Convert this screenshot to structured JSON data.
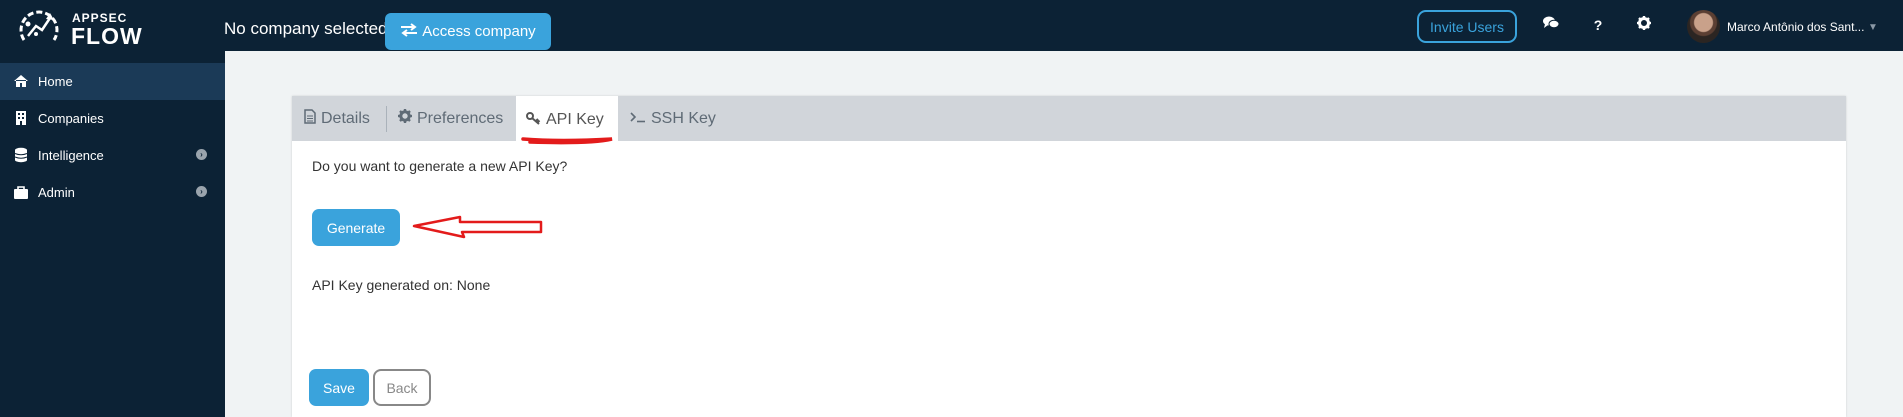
{
  "brand": {
    "line1": "APPSEC",
    "line2": "FLOW"
  },
  "header": {
    "company_status": "No company selected",
    "access_company_label": "Access company",
    "invite_users_label": "Invite Users",
    "help_label": "?",
    "user_name": "Marco Antônio dos Sant...",
    "icons": [
      "chat-icon",
      "help-icon",
      "gear-icon",
      "caret-down-icon"
    ]
  },
  "sidebar": {
    "items": [
      {
        "label": "Home",
        "icon": "home-icon",
        "active": true
      },
      {
        "label": "Companies",
        "icon": "building-icon",
        "active": false
      },
      {
        "label": "Intelligence",
        "icon": "database-icon",
        "active": false,
        "expandable": true
      },
      {
        "label": "Admin",
        "icon": "briefcase-icon",
        "active": false,
        "expandable": true
      }
    ]
  },
  "tabs": [
    {
      "label": "Details",
      "icon": "document-icon",
      "active": false
    },
    {
      "label": "Preferences",
      "icon": "gear-icon",
      "active": false
    },
    {
      "label": "API Key",
      "icon": "key-icon",
      "active": true
    },
    {
      "label": "SSH Key",
      "icon": "terminal-icon",
      "active": false
    }
  ],
  "api_key": {
    "question": "Do you want to generate a new API Key?",
    "generate_label": "Generate",
    "generated_on_label": "API Key generated on: None"
  },
  "form": {
    "save_label": "Save",
    "back_label": "Back"
  },
  "colors": {
    "navy": "#0c2235",
    "accent": "#3aa3dc",
    "annotation": "#e31b1b",
    "tabbar": "#d1d5da"
  }
}
